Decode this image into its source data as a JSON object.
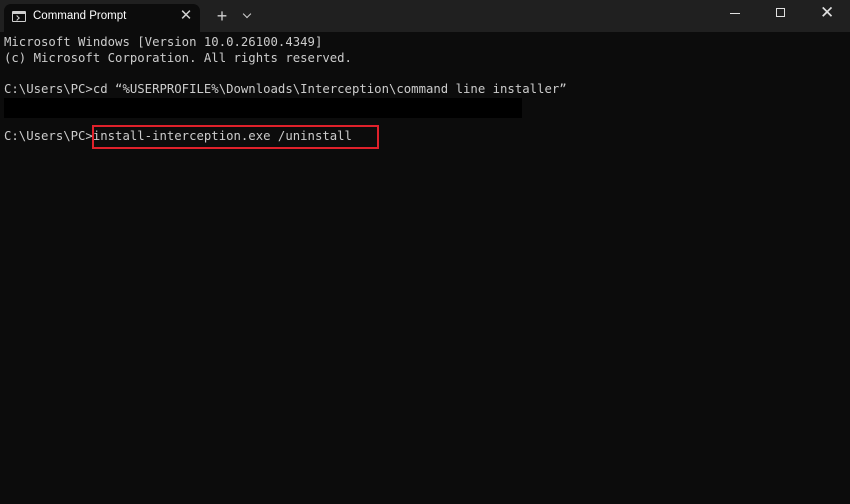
{
  "window": {
    "tab_title": "Command Prompt",
    "tab_close": "✕",
    "new_tab": "+",
    "close_glyph": "✕"
  },
  "terminal": {
    "lines": [
      "Microsoft Windows [Version 10.0.26100.4349]",
      "(c) Microsoft Corporation. All rights reserved.",
      "",
      "C:\\Users\\PC>cd “%USERPROFILE%\\Downloads\\Interception\\command line installer”",
      "",
      "C:\\Users\\PC>install-interception.exe /uninstall"
    ]
  },
  "colors": {
    "background": "#0c0c0c",
    "titlebar": "#202020",
    "text": "#cccccc",
    "highlight_border": "#e0212b"
  },
  "icons": [
    "terminal-icon",
    "close-icon",
    "plus-icon",
    "chevron-down-icon",
    "minimize-icon",
    "maximize-icon",
    "close-icon"
  ]
}
